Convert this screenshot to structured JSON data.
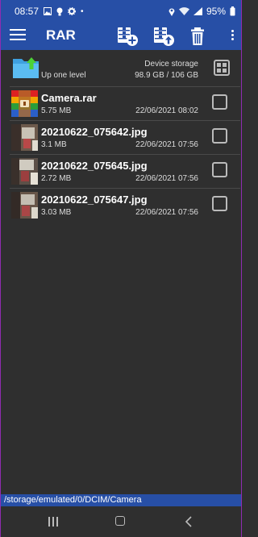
{
  "status_bar": {
    "time": "08:57",
    "battery": "95%"
  },
  "toolbar": {
    "title": "RAR"
  },
  "up_level": {
    "label": "Up one level",
    "storage_label": "Device storage",
    "storage_size": "98.9 GB / 106 GB"
  },
  "files": [
    {
      "name": "Camera.rar",
      "size": "5.75 MB",
      "date": "22/06/2021 08:02",
      "kind": "archive"
    },
    {
      "name": "20210622_075642.jpg",
      "size": "3.1 MB",
      "date": "22/06/2021 07:56",
      "kind": "image"
    },
    {
      "name": "20210622_075645.jpg",
      "size": "2.72 MB",
      "date": "22/06/2021 07:56",
      "kind": "image"
    },
    {
      "name": "20210622_075647.jpg",
      "size": "3.03 MB",
      "date": "22/06/2021 07:56",
      "kind": "image"
    }
  ],
  "path": "/storage/emulated/0/DCIM/Camera",
  "colors": {
    "accent": "#274fa6",
    "background": "#2f2f2f"
  }
}
